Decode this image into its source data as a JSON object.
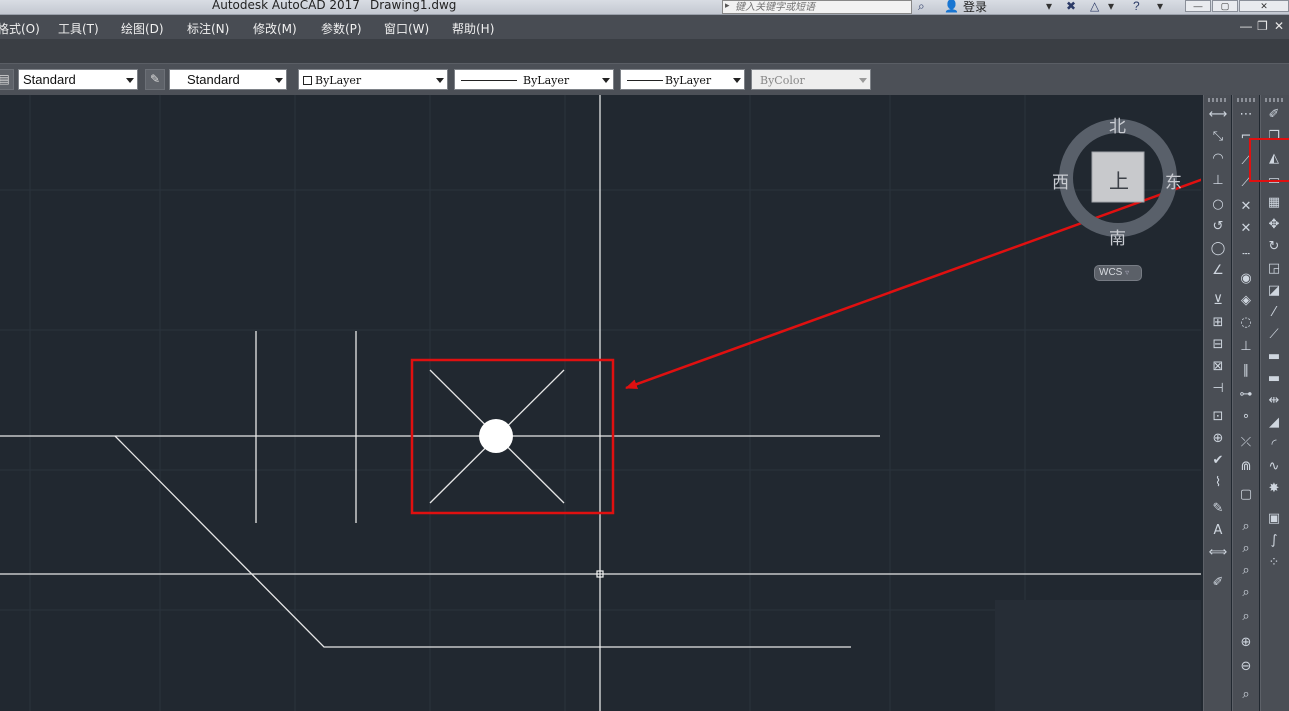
{
  "window": {
    "app_title": "Autodesk AutoCAD 2017",
    "file_name": "Drawing1.dwg",
    "search_placeholder": "键入关键字或短语",
    "login_label": "登录",
    "controls": [
      "—",
      "▢",
      "✕"
    ]
  },
  "menubar": {
    "items": [
      "格式(O)",
      "工具(T)",
      "绘图(D)",
      "标注(N)",
      "修改(M)",
      "参数(P)",
      "窗口(W)",
      "帮助(H)"
    ],
    "doc_controls": [
      "—",
      "❐",
      "✕"
    ]
  },
  "properties_toolbar": {
    "text_style": "Standard",
    "dim_style": "Standard",
    "color": "ByLayer",
    "linetype": "ByLayer",
    "lineweight": "ByLayer",
    "plot_style": "ByColor"
  },
  "viewcube": {
    "north": "北",
    "south": "南",
    "east": "东",
    "west": "西",
    "face": "上",
    "wcs_label": "WCS"
  },
  "colors": {
    "canvas": "#212830",
    "highlight": "#e01010",
    "geometry": "#e6e6e6"
  }
}
